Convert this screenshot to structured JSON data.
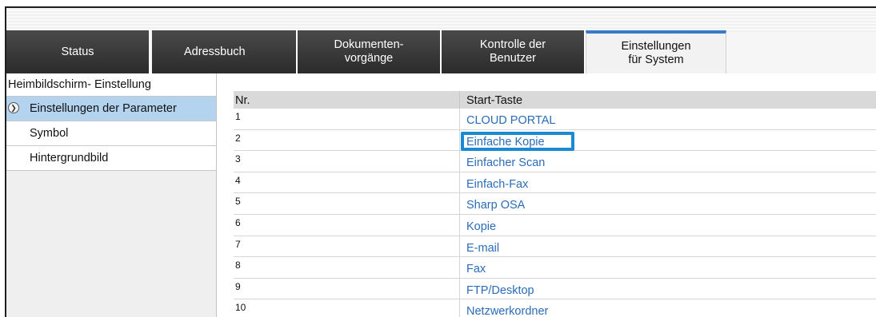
{
  "tabs": [
    {
      "label": "Status"
    },
    {
      "label": "Adressbuch"
    },
    {
      "label": "Dokumenten-\nvorgänge"
    },
    {
      "label": "Kontrolle der\nBenutzer"
    },
    {
      "label": "Einstellungen\nfür System"
    }
  ],
  "sidebar": {
    "header": "Heimbildschirm- Einstellung",
    "items": [
      {
        "label": "Einstellungen der Parameter",
        "selected": true,
        "icon": "chevron-circle-icon"
      },
      {
        "label": "Symbol"
      },
      {
        "label": "Hintergrundbild"
      }
    ]
  },
  "table": {
    "columns": [
      "Nr.",
      "Start-Taste"
    ],
    "rows": [
      {
        "nr": "1",
        "key": "CLOUD PORTAL"
      },
      {
        "nr": "2",
        "key": "Einfache Kopie"
      },
      {
        "nr": "3",
        "key": "Einfacher Scan"
      },
      {
        "nr": "4",
        "key": "Einfach-Fax"
      },
      {
        "nr": "5",
        "key": "Sharp OSA"
      },
      {
        "nr": "6",
        "key": "Kopie"
      },
      {
        "nr": "7",
        "key": "E-mail"
      },
      {
        "nr": "8",
        "key": "Fax"
      },
      {
        "nr": "9",
        "key": "FTP/Desktop"
      },
      {
        "nr": "10",
        "key": "Netzwerkordner"
      }
    ]
  },
  "colors": {
    "accent": "#3a78c8",
    "link": "#2a6cb8",
    "selected_bg": "#b4d3ef",
    "highlight": "#1a8ad4"
  }
}
